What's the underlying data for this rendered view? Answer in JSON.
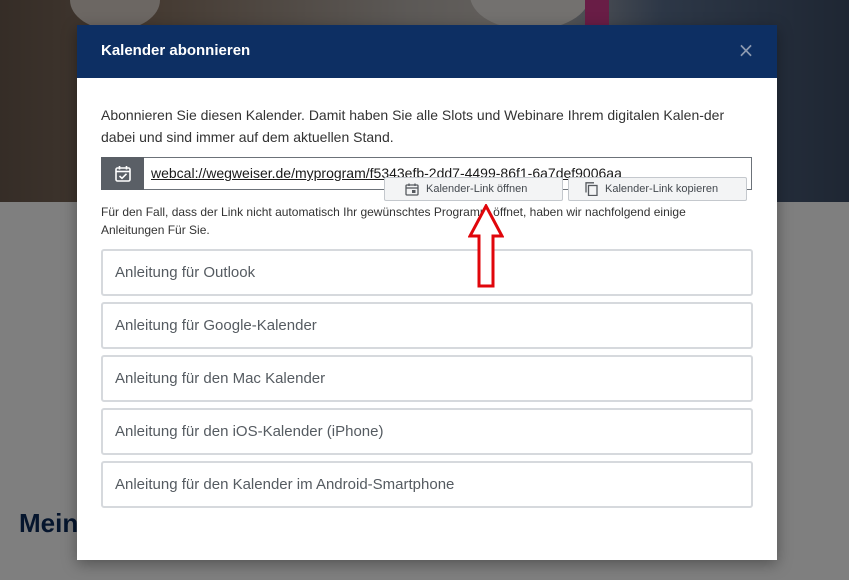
{
  "background": {
    "heading": "Mein"
  },
  "modal": {
    "title": "Kalender abonnieren",
    "close_glyph": "×",
    "intro": "Abonnieren Sie diesen Kalender. Damit haben Sie alle Slots und Webinare Ihrem digitalen Kalen-der dabei und sind immer auf dem aktuellen Stand.",
    "link": {
      "url": "webcal://wegweiser.de/myprogram/f5343efb-2dd7-4499-86f1-6a7def9006aa",
      "icon": "calendar-check-icon"
    },
    "buttons": {
      "open_label": "Kalender-Link öffnen",
      "open_icon": "calendar-open-icon",
      "copy_label": "Kalender-Link kopieren",
      "copy_icon": "copy-icon"
    },
    "note": "Für den Fall, dass der Link nicht automatisch Ihr gewünschtes Programm öffnet, haben wir nachfolgend einige Anleitungen Für Sie.",
    "guides": [
      {
        "label": "Anleitung für Outlook"
      },
      {
        "label": "Anleitung für Google-Kalender"
      },
      {
        "label": "Anleitung für den Mac Kalender"
      },
      {
        "label": "Anleitung für den iOS-Kalender (iPhone)"
      },
      {
        "label": "Anleitung für den Kalender im Android-Smartphone"
      }
    ]
  },
  "annotation": {
    "icon": "red-up-arrow-icon",
    "color": "#e0060b"
  },
  "colors": {
    "header_bg": "#0d2f63",
    "icon_box_bg": "#5a5f66",
    "guide_border": "#d6d9dd"
  }
}
